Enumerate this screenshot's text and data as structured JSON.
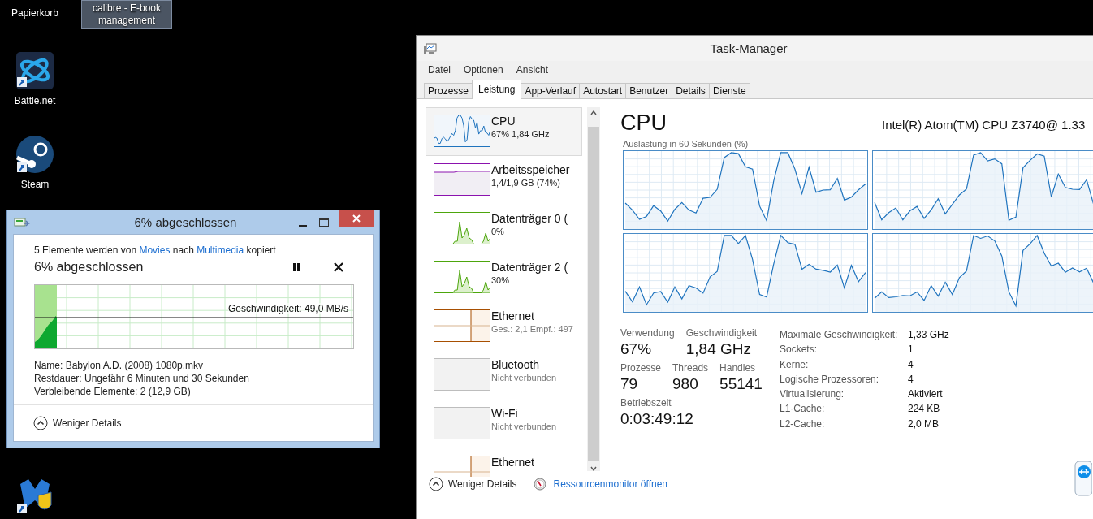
{
  "desktop_icons": [
    {
      "label": "Papierkorb",
      "kind": "recycle-bin",
      "selected": false
    },
    {
      "label": "calibre - E-book management",
      "kind": "calibre",
      "selected": true
    },
    {
      "label": "Battle.net",
      "kind": "battlenet",
      "selected": false
    },
    {
      "label": "Steam",
      "kind": "steam",
      "selected": false
    },
    {
      "kind": "malwarebytes",
      "selected": false
    }
  ],
  "copy_dialog": {
    "title": "6% abgeschlossen",
    "message": [
      {
        "kind": "text",
        "text": "5 Elemente werden von"
      },
      {
        "kind": "link",
        "text": "Movies"
      },
      {
        "kind": "text",
        "text": "nach"
      },
      {
        "kind": "link",
        "text": "Multimedia"
      },
      {
        "kind": "text",
        "text": "kopiert"
      }
    ],
    "heading": "6% abgeschlossen",
    "level": 0.06,
    "speed": "Geschwindigkeit: 49,0 MB/s",
    "details": [
      {
        "label": "Name:",
        "value": "Babylon A.D. (2008) 1080p.mkv"
      },
      {
        "label": "Restdauer:",
        "value": "Ungefähr 6 Minuten und 30 Sekunden"
      },
      {
        "label": "Verbleibende Elemente:",
        "value": "2 (12,9 GB)"
      }
    ],
    "toggle": "Weniger Details"
  },
  "task_manager": {
    "title": "Task-Manager",
    "menu": [
      "Datei",
      "Optionen",
      "Ansicht"
    ],
    "tabs": [
      {
        "label": "Prozesse",
        "selected": false
      },
      {
        "label": "Leistung",
        "selected": true
      },
      {
        "label": "App-Verlauf",
        "selected": false
      },
      {
        "label": "Autostart",
        "selected": false
      },
      {
        "label": "Benutzer",
        "selected": false
      },
      {
        "label": "Details",
        "selected": false
      },
      {
        "label": "Dienste",
        "selected": false
      }
    ],
    "resources": [
      {
        "name": "CPU",
        "detail": "67% 1,84 GHz",
        "kind": "cpu",
        "selected": true
      },
      {
        "name": "Arbeitsspeicher",
        "detail": "1,4/1,9 GB (74%)",
        "kind": "memory",
        "selected": false
      },
      {
        "name": "Datenträger 0 (",
        "detail": "0%",
        "kind": "disk",
        "selected": false
      },
      {
        "name": "Datenträger 2 (",
        "detail": "30%",
        "kind": "disk",
        "selected": false
      },
      {
        "name": "Ethernet",
        "detail": "Ges.: 2,1 Empf.: 497",
        "kind": "network",
        "selected": false
      },
      {
        "name": "Bluetooth",
        "detail": "Nicht verbunden",
        "kind": "inactive",
        "selected": false
      },
      {
        "name": "Wi-Fi",
        "detail": "Nicht verbunden",
        "kind": "inactive",
        "selected": false
      },
      {
        "name": "Ethernet",
        "kind": "network",
        "selected": false
      }
    ],
    "detail_title": "CPU",
    "processor": "Intel(R) Atom(TM) CPU Z3740@ 1.33",
    "graph_caption": "Auslastung in 60 Sekunden (%)",
    "stat_rows": [
      [
        {
          "label": "Verwendung",
          "value": "67%"
        },
        {
          "label": "Geschwindigkeit",
          "value": "1,84 GHz"
        }
      ],
      [
        {
          "label": "Prozesse",
          "value": "79"
        },
        {
          "label": "Threads",
          "value": "980"
        },
        {
          "label": "Handles",
          "value": "55141"
        }
      ],
      [
        {
          "label": "Betriebszeit",
          "value": "0:03:49:12"
        }
      ]
    ],
    "properties": [
      {
        "label": "Maximale Geschwindigkeit:",
        "value": "1,33 GHz"
      },
      {
        "label": "Sockets:",
        "value": "1"
      },
      {
        "label": "Kerne:",
        "value": "4"
      },
      {
        "label": "Logische Prozessoren:",
        "value": "4"
      },
      {
        "label": "Virtualisierung:",
        "value": "Aktiviert"
      },
      {
        "label": "L1-Cache:",
        "value": "224 KB"
      },
      {
        "label": "L2-Cache:",
        "value": "2,0 MB"
      }
    ],
    "footer": {
      "toggle": "Weniger Details",
      "link": "Ressourcenmonitor öffnen"
    }
  }
}
